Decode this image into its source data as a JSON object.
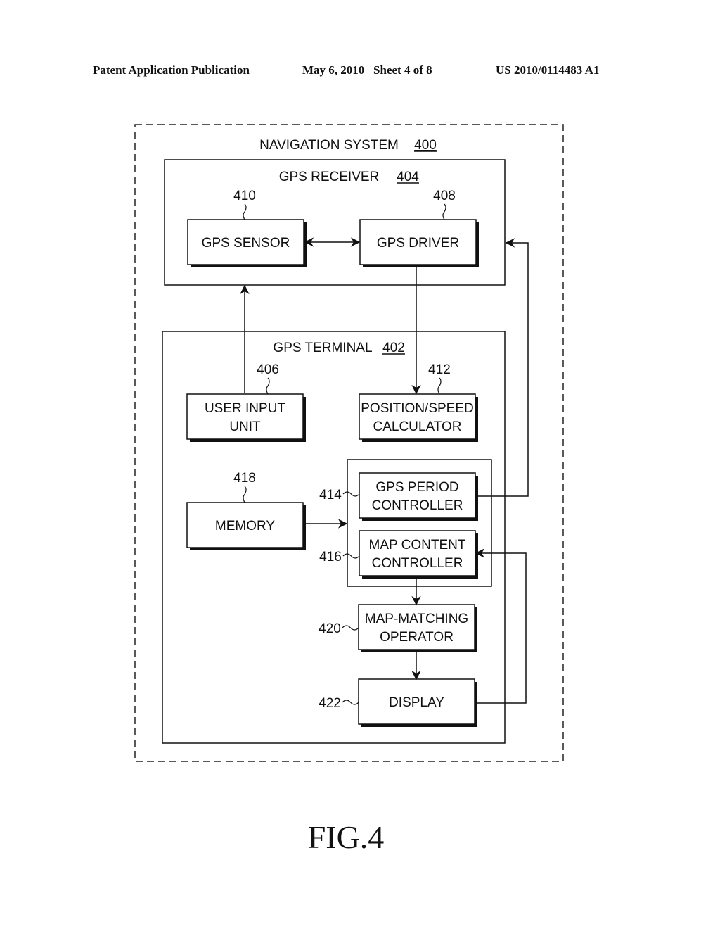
{
  "header": {
    "left": "Patent Application Publication",
    "middle": "May 6, 2010   Sheet 4 of 8",
    "right": "US 2010/0114483 A1"
  },
  "diagram": {
    "system": {
      "label": "NAVIGATION SYSTEM",
      "ref": "400"
    },
    "receiver": {
      "label": "GPS RECEIVER",
      "ref": "404"
    },
    "terminal": {
      "label": "GPS TERMINAL",
      "ref": "402"
    },
    "blocks": {
      "gps_sensor": {
        "lines": [
          "GPS SENSOR"
        ],
        "ref": "410"
      },
      "gps_driver": {
        "lines": [
          "GPS DRIVER"
        ],
        "ref": "408"
      },
      "user_input": {
        "lines": [
          "USER INPUT",
          "UNIT"
        ],
        "ref": "406"
      },
      "pos_speed": {
        "lines": [
          "POSITION/SPEED",
          "CALCULATOR"
        ],
        "ref": "412"
      },
      "memory": {
        "lines": [
          "MEMORY"
        ],
        "ref": "418"
      },
      "gps_period": {
        "lines": [
          "GPS PERIOD",
          "CONTROLLER"
        ],
        "ref": "414"
      },
      "map_content": {
        "lines": [
          "MAP CONTENT",
          "CONTROLLER"
        ],
        "ref": "416"
      },
      "map_matching": {
        "lines": [
          "MAP-MATCHING",
          "OPERATOR"
        ],
        "ref": "420"
      },
      "display": {
        "lines": [
          "DISPLAY"
        ],
        "ref": "422"
      }
    }
  },
  "figure_label": "FIG.4"
}
